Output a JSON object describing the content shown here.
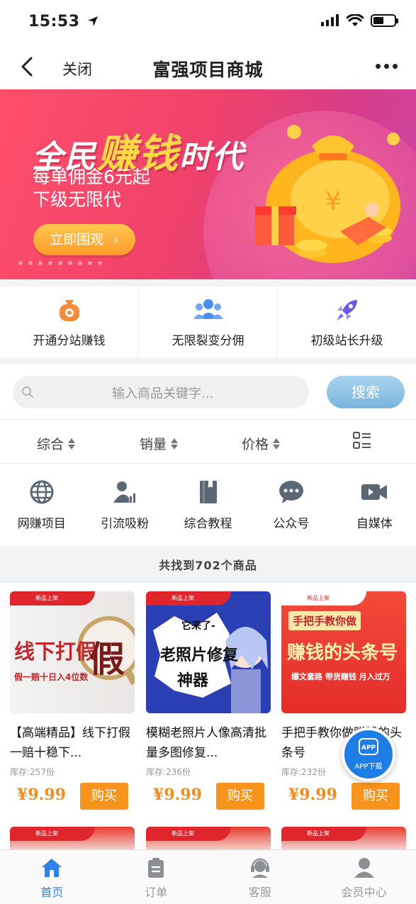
{
  "status_bar": {
    "time": "15:53"
  },
  "nav": {
    "close_label": "关闭",
    "title": "富强项目商城"
  },
  "banner": {
    "headline_pre": "全民",
    "headline_highlight": "赚钱",
    "headline_post": "时代",
    "line1": "每单佣金6元起",
    "line2": "下级无限代",
    "button_label": "立即围观"
  },
  "features": [
    {
      "label": "开通分站赚钱",
      "icon": "money-bag-icon"
    },
    {
      "label": "无限裂变分佣",
      "icon": "users-icon"
    },
    {
      "label": "初级站长升级",
      "icon": "rocket-icon"
    }
  ],
  "search": {
    "placeholder": "输入商品关键字...",
    "button_label": "搜索"
  },
  "sort": [
    {
      "label": "综合"
    },
    {
      "label": "销量"
    },
    {
      "label": "价格"
    }
  ],
  "categories": [
    {
      "label": "网赚项目",
      "icon": "globe-icon"
    },
    {
      "label": "引流吸粉",
      "icon": "user-chart-icon"
    },
    {
      "label": "综合教程",
      "icon": "book-icon"
    },
    {
      "label": "公众号",
      "icon": "chat-bubble-icon"
    },
    {
      "label": "自媒体",
      "icon": "video-camera-icon"
    }
  ],
  "result_text": "共找到702个商品",
  "products": [
    {
      "tag": "新品上架",
      "image_text_1": "线下打假",
      "image_text_2": "假",
      "image_text_3": "假一赔十日入4位数",
      "title": "【高端精品】线下打假一赔十稳下...",
      "stock": "库存:257份",
      "price": "¥9.99",
      "buy_label": "购买"
    },
    {
      "tag": "新品上架",
      "image_text_1": "它来了-",
      "image_text_2": "老照片修复",
      "image_text_3": "神器",
      "title": "模糊老照片人像高清批量多图修复...",
      "stock": "库存:236份",
      "price": "¥9.99",
      "buy_label": "购买"
    },
    {
      "tag": "新品上架",
      "image_text_1": "手把手教你做",
      "image_text_2": "赚钱的头条号",
      "image_text_3": "爆文套路  带货赚钱  月入过万",
      "title": "手把手教你做赚钱的头条号",
      "stock": "库存:232份",
      "price": "¥9.99",
      "buy_label": "购买"
    }
  ],
  "app_float": {
    "badge": "APP",
    "label": "APP下载"
  },
  "tabs": [
    {
      "label": "首页",
      "icon": "home-icon",
      "active": true
    },
    {
      "label": "订单",
      "icon": "order-icon",
      "active": false
    },
    {
      "label": "客服",
      "icon": "headset-icon",
      "active": false
    },
    {
      "label": "会员中心",
      "icon": "person-icon",
      "active": false
    }
  ],
  "colors": {
    "accent_blue": "#2f80e7",
    "price_orange": "#f28c1e",
    "buy_button": "#f7941d",
    "banner_pink": "#f0426a"
  }
}
